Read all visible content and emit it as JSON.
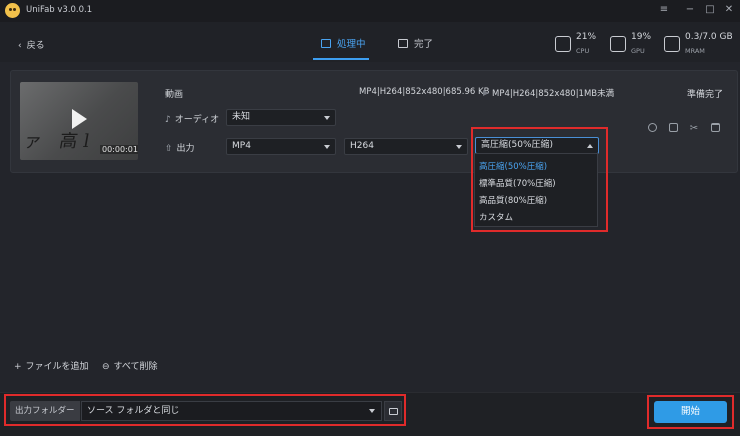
{
  "app": {
    "title": "UniFab v3.0.0.1"
  },
  "window_controls": {
    "menu": "≡",
    "minimize": "−",
    "maximize": "□",
    "close": "✕"
  },
  "nav": {
    "back_label": "戻る",
    "tabs": [
      {
        "label": "処理中",
        "active": true
      },
      {
        "label": "完了",
        "active": false
      }
    ]
  },
  "resources": [
    {
      "value": "21%",
      "label": "CPU"
    },
    {
      "value": "19%",
      "label": "GPU"
    },
    {
      "value": "0.3/7.0 GB",
      "label": "MRAM"
    }
  ],
  "task": {
    "thumbnail_duration": "00:00:01",
    "video_label": "動画",
    "input_info": "MP4|H264|852x480|685.96 KB",
    "output_info": "MP4|H264|852x480|1MB未満",
    "status": "準備完了",
    "audio_label": "オーディオ",
    "audio_value": "未知",
    "output_label": "出力",
    "format_value": "MP4",
    "codec_value": "H264",
    "quality_value": "高圧縮(50%圧縮)"
  },
  "quality_options": [
    {
      "label": "高圧縮(50%圧縮)",
      "selected": true
    },
    {
      "label": "標準品質(70%圧縮)",
      "selected": false
    },
    {
      "label": "高品質(80%圧縮)",
      "selected": false
    },
    {
      "label": "カスタム",
      "selected": false
    }
  ],
  "footer": {
    "add_file": "ファイルを追加",
    "delete_all": "すべて削除",
    "output_folder_label": "出力フォルダー",
    "output_folder_value": "ソース フォルダと同じ",
    "start_button": "開始"
  },
  "colors": {
    "accent": "#2f9be6",
    "highlight": "#e02b2b",
    "selected_text": "#4aa3f0"
  }
}
